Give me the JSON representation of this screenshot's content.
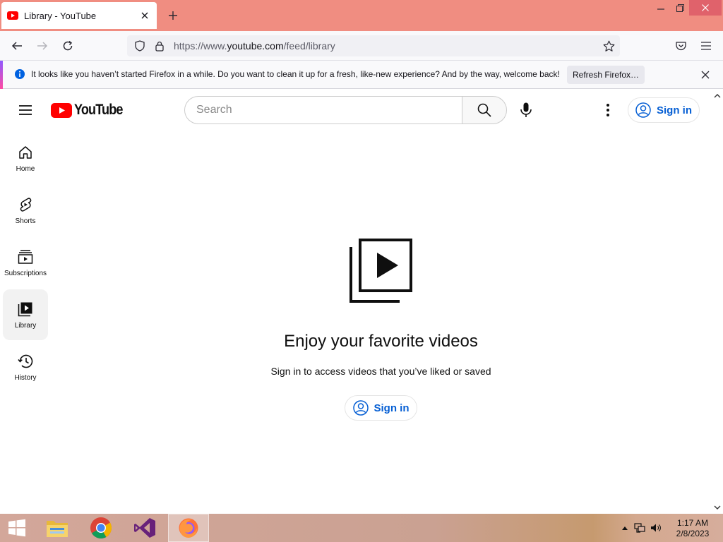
{
  "browser": {
    "tab_title": "Library - YouTube",
    "url_prefix": "https://www.",
    "url_domain": "youtube.com",
    "url_path": "/feed/library",
    "notification_message": "It looks like you haven’t started Firefox in a while. Do you want to clean it up for a fresh, like-new experience? And by the way, welcome back!",
    "notification_button": "Refresh Firefox…"
  },
  "youtube": {
    "logo_text": "YouTube",
    "search_placeholder": "Search",
    "signin_label": "Sign in",
    "brand_red": "#ff0000",
    "link_blue": "#065fd4"
  },
  "sidebar": {
    "items": [
      {
        "label": "Home",
        "icon": "home-icon"
      },
      {
        "label": "Shorts",
        "icon": "shorts-icon"
      },
      {
        "label": "Subscriptions",
        "icon": "subscriptions-icon"
      },
      {
        "label": "Library",
        "icon": "library-icon",
        "active": true
      },
      {
        "label": "History",
        "icon": "history-icon"
      }
    ]
  },
  "main": {
    "title": "Enjoy your favorite videos",
    "subtitle": "Sign in to access videos that you’ve liked or saved",
    "signin_label": "Sign in"
  },
  "taskbar": {
    "apps": [
      "windows-start-icon",
      "file-explorer-icon",
      "chrome-icon",
      "visual-studio-icon",
      "firefox-icon"
    ],
    "time": "1:17 AM",
    "date": "2/8/2023"
  }
}
